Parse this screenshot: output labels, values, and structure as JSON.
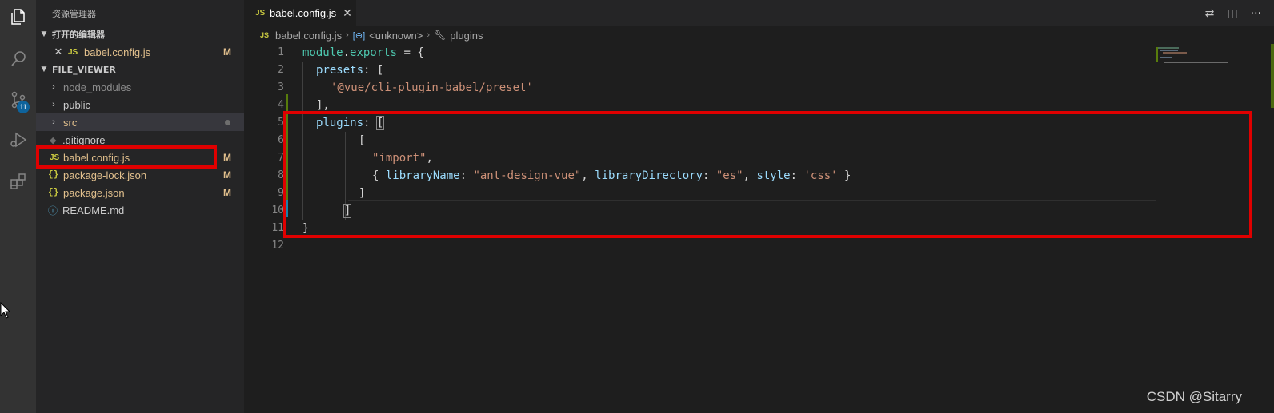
{
  "sidebar": {
    "title": "资源管理器",
    "open_editors": {
      "heading": "打开的编辑器",
      "items": [
        {
          "icon": "js-file-icon",
          "label": "babel.config.js",
          "status": "M"
        }
      ]
    },
    "project": {
      "heading": "FILE_VIEWER",
      "items": [
        {
          "label": "node_modules",
          "type": "folder"
        },
        {
          "label": "public",
          "type": "folder"
        },
        {
          "label": "src",
          "type": "folder"
        },
        {
          "label": ".gitignore",
          "type": "file"
        },
        {
          "label": "babel.config.js",
          "type": "file",
          "status": "M"
        },
        {
          "label": "package-lock.json",
          "type": "file",
          "status": "M"
        },
        {
          "label": "package.json",
          "type": "file",
          "status": "M"
        },
        {
          "label": "README.md",
          "type": "file"
        }
      ]
    }
  },
  "activitybar": {
    "scm_badge": "11"
  },
  "editor": {
    "tab": {
      "icon_text": "JS",
      "label": "babel.config.js"
    },
    "breadcrumb": [
      "babel.config.js",
      "<unknown>",
      "plugins"
    ],
    "line_numbers": [
      "1",
      "2",
      "3",
      "4",
      "5",
      "6",
      "7",
      "8",
      "9",
      "10",
      "11",
      "12"
    ],
    "code": {
      "l1": [
        "module",
        ".",
        "exports",
        " = {"
      ],
      "l2": [
        "presets",
        ": ["
      ],
      "l3": [
        "'@vue/cli-plugin-babel/preset'"
      ],
      "l4": [
        "],"
      ],
      "l5": [
        "plugins",
        ": ",
        "["
      ],
      "l6": [
        "["
      ],
      "l7": [
        "\"import\"",
        ","
      ],
      "l8": [
        "{ ",
        "libraryName",
        ": ",
        "\"ant-design-vue\"",
        ", ",
        "libraryDirectory",
        ": ",
        "\"es\"",
        ", ",
        "style",
        ": ",
        "'css'",
        " }"
      ],
      "l9": [
        "]"
      ],
      "l10": [
        "]"
      ],
      "l11": [
        "}"
      ]
    }
  },
  "watermark": "CSDN @Sitarry",
  "colors": {
    "highlight_box": "#e00000",
    "modified": "#e2c08d",
    "badge": "#0e639c"
  }
}
